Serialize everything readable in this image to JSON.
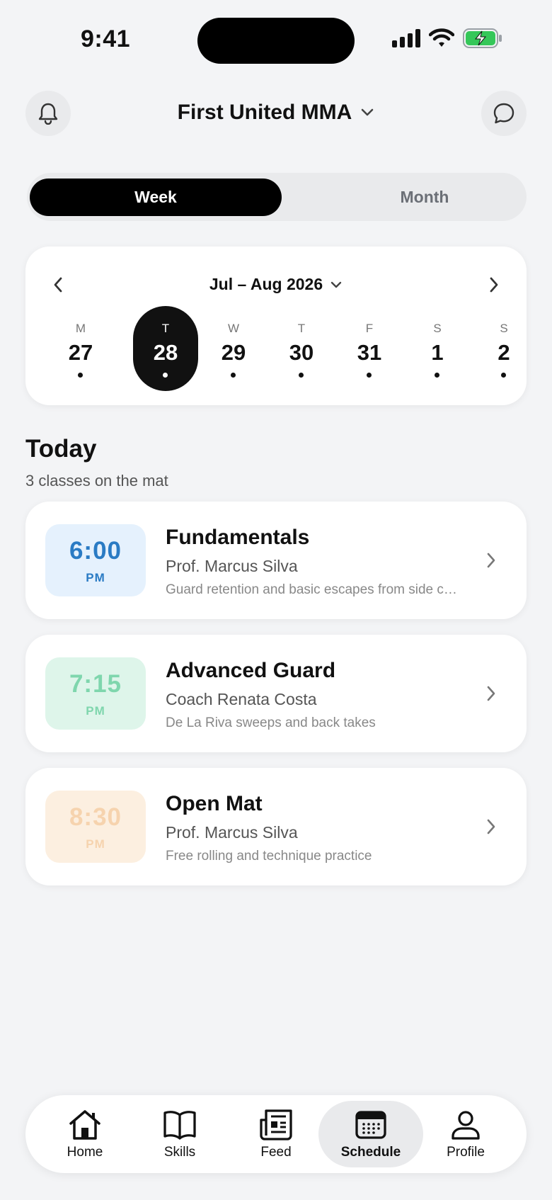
{
  "status_bar": {
    "time": "9:41"
  },
  "header": {
    "title": "First United MMA"
  },
  "view_toggle": {
    "week": "Week",
    "month": "Month"
  },
  "calendar": {
    "range_label": "Jul – Aug 2026",
    "days": [
      {
        "dow": "M",
        "num": "27",
        "selected": false
      },
      {
        "dow": "T",
        "num": "28",
        "selected": true
      },
      {
        "dow": "W",
        "num": "29",
        "selected": false
      },
      {
        "dow": "T",
        "num": "30",
        "selected": false
      },
      {
        "dow": "F",
        "num": "31",
        "selected": false
      },
      {
        "dow": "S",
        "num": "1",
        "selected": false
      },
      {
        "dow": "S",
        "num": "2",
        "selected": false
      }
    ]
  },
  "today": {
    "title": "Today",
    "subtitle": "3 classes on the mat",
    "classes": [
      {
        "time": "6:00",
        "ampm": "PM",
        "title": "Fundamentals",
        "coach": "Prof. Marcus Silva",
        "desc": "Guard retention and basic escapes from side control",
        "bg": "#e5f1fd",
        "fg": "#2a7bc4"
      },
      {
        "time": "7:15",
        "ampm": "PM",
        "title": "Advanced Guard",
        "coach": "Coach Renata Costa",
        "desc": "De La Riva sweeps and back takes",
        "bg": "#def5ea",
        "fg": "#7fd6ad"
      },
      {
        "time": "8:30",
        "ampm": "PM",
        "title": "Open Mat",
        "coach": "Prof. Marcus Silva",
        "desc": "Free rolling and technique practice",
        "bg": "#fcefe0",
        "fg": "#f6d3ae"
      }
    ]
  },
  "tabbar": {
    "active": "Schedule",
    "items": [
      {
        "label": "Home",
        "icon": "home-icon"
      },
      {
        "label": "Skills",
        "icon": "book-icon"
      },
      {
        "label": "Feed",
        "icon": "newspaper-icon"
      },
      {
        "label": "Schedule",
        "icon": "calendar-icon"
      },
      {
        "label": "Profile",
        "icon": "person-icon"
      }
    ]
  }
}
